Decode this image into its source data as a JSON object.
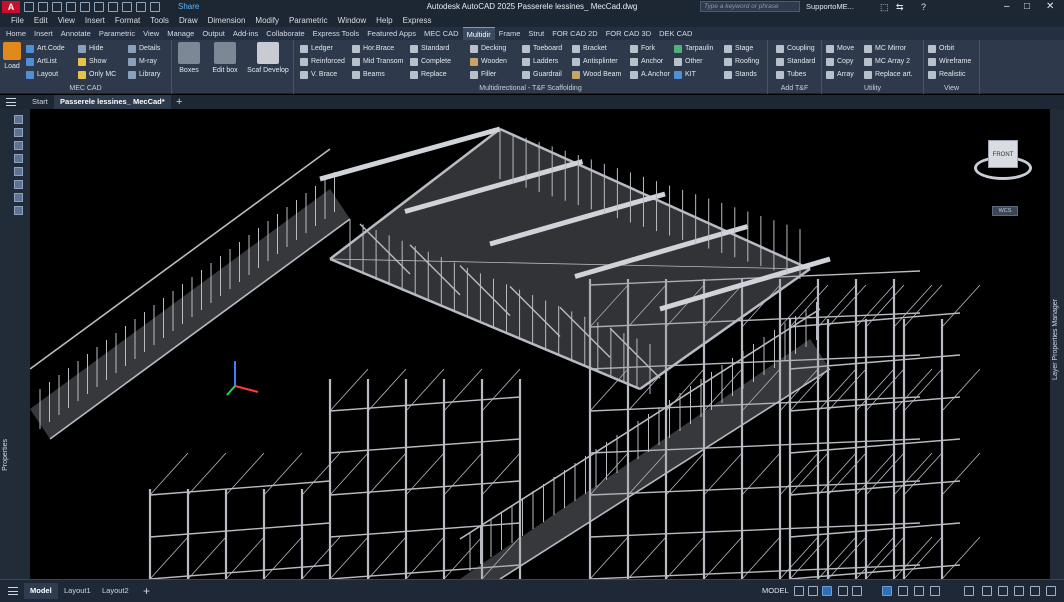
{
  "titlebar": {
    "app_logo": "A",
    "share": "Share",
    "title": "Autodesk AutoCAD 2025    Passerele lessines_ MecCad.dwg",
    "search_placeholder": "Type a keyword or phrase",
    "user": "SupportoME..."
  },
  "menu": [
    "File",
    "Edit",
    "View",
    "Insert",
    "Format",
    "Tools",
    "Draw",
    "Dimension",
    "Modify",
    "Parametric",
    "Window",
    "Help",
    "Express"
  ],
  "ribbon_tabs": [
    "Home",
    "Insert",
    "Annotate",
    "Parametric",
    "View",
    "Manage",
    "Output",
    "Add-ins",
    "Collaborate",
    "Express Tools",
    "Featured Apps",
    "MEC CAD",
    "Multidir",
    "Frame",
    "Strut",
    "FOR CAD 2D",
    "FOR CAD 3D",
    "DEK CAD"
  ],
  "active_ribbon_tab": "Multidir",
  "ribbon": {
    "load": "Load",
    "mec_cad": {
      "label": "MEC CAD",
      "col1": [
        "Art.Code",
        "ArtList",
        "Layout"
      ],
      "col2": [
        "Hide",
        "Show",
        "Only MC"
      ],
      "col3": [
        "Details",
        "M-ray",
        "Library"
      ]
    },
    "big_buttons": [
      "Boxes",
      "Edit box",
      "Scaf Develop"
    ],
    "multidir": {
      "label": "Multidirectional - T&F Scaffolding",
      "col1": [
        "Ledger",
        "Reinforced",
        "V. Brace"
      ],
      "col2": [
        "Hor.Brace",
        "Mid Transom",
        "Beams"
      ],
      "col3": [
        "Standard",
        "Complete",
        "Replace"
      ],
      "col4": [
        "Decking",
        "Wooden",
        "Filler"
      ],
      "col5": [
        "Toeboard",
        "Ladders",
        "Guardrail"
      ],
      "col6": [
        "Bracket",
        "Antisplinter",
        "Wood Beam"
      ],
      "col7": [
        "Fork",
        "Anchor",
        "A.Anchor"
      ],
      "col8": [
        "Tarpaulin",
        "Other",
        "KIT"
      ],
      "col9": [
        "Stage",
        "Roofing",
        "Stands"
      ]
    },
    "add_tf": {
      "label": "Add T&F",
      "col1": [
        "Coupling",
        "Standard",
        "Tubes"
      ]
    },
    "utility": {
      "label": "Utility",
      "col1": [
        "Move",
        "Copy",
        "Array"
      ],
      "col2": [
        "MC Mirror",
        "MC Array 2",
        "Replace art."
      ]
    },
    "view": {
      "label": "View",
      "col1": [
        "Orbit",
        "Wireframe",
        "Realistic"
      ]
    }
  },
  "file_tabs": [
    "Start",
    "Passerele lessines_ MecCad*"
  ],
  "palettes": {
    "left": "Properties",
    "right": "Layer Properties Manager"
  },
  "viewcube": {
    "face": "FRONT",
    "wcs": "WCS"
  },
  "status": {
    "layouts": [
      "Model",
      "Layout1",
      "Layout2"
    ],
    "model": "MODEL"
  },
  "colors": {
    "accent": "#2f6fb5",
    "ribbon_bg": "#2e3a4b",
    "viewport_bg": "#000000",
    "scaffold": "#b8bcc2"
  }
}
